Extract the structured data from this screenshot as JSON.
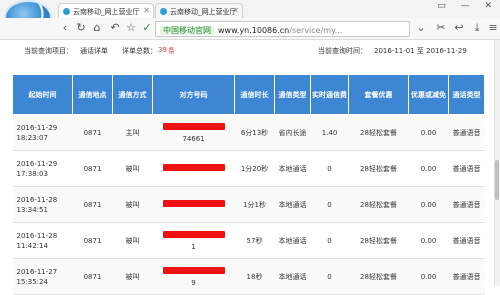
{
  "browser": {
    "tabs": [
      {
        "title": "云南移动_网上营业厅"
      },
      {
        "title": "云南移动_网上营业厅"
      }
    ],
    "url": {
      "site_label": "中国移动官网",
      "host": "www.yn.10086.cn",
      "path": "/service/my..."
    }
  },
  "query_info": {
    "project_label": "当前查询项目：",
    "project": "通话详单",
    "total_label": "详单总数：",
    "total": "39",
    "total_unit": "条",
    "period_label": "当前查询时间：",
    "period": "2016-11-01 至 2016-11-29"
  },
  "table": {
    "headers": [
      "起始时间",
      "通信地点",
      "通信方式",
      "对方号码",
      "通信时长",
      "通信类型",
      "实时通信费",
      "套餐优惠",
      "优惠或减免",
      "通话类型"
    ],
    "rows": [
      {
        "time": "2016-11-29 18:23:07",
        "place": "0871",
        "mode": "主叫",
        "number_tail": "74661",
        "duration": "6分13秒",
        "type": "省内长途",
        "fee": "1.40",
        "package": "28轻松套餐",
        "discount": "0.00",
        "call_type": "普通语音"
      },
      {
        "time": "2016-11-29 17:38:03",
        "place": "0871",
        "mode": "被叫",
        "number_tail": "",
        "duration": "1分20秒",
        "type": "本地通话",
        "fee": "0",
        "package": "28轻松套餐",
        "discount": "0.00",
        "call_type": "普通语音"
      },
      {
        "time": "2016-11-28 13:34:51",
        "place": "0871",
        "mode": "被叫",
        "number_tail": "",
        "duration": "1分1秒",
        "type": "本地通话",
        "fee": "0",
        "package": "28轻松套餐",
        "discount": "0.00",
        "call_type": "普通语音"
      },
      {
        "time": "2016-11-28 11:42:14",
        "place": "0871",
        "mode": "被叫",
        "number_tail": "1",
        "duration": "57秒",
        "type": "本地通话",
        "fee": "0",
        "package": "28轻松套餐",
        "discount": "0.00",
        "call_type": "普通语音"
      },
      {
        "time": "2016-11-27 15:35:24",
        "place": "0871",
        "mode": "被叫",
        "number_tail": "9",
        "duration": "18秒",
        "type": "本地通话",
        "fee": "0",
        "package": "28轻松套餐",
        "discount": "0.00",
        "call_type": "普通语音"
      }
    ]
  }
}
